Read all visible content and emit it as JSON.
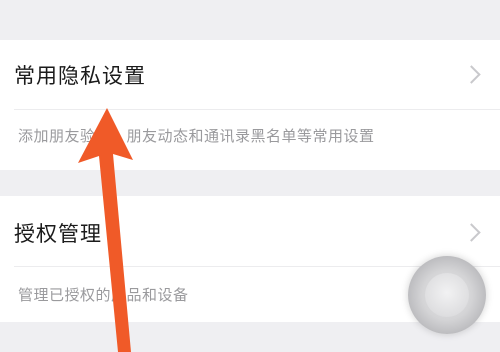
{
  "settings": {
    "items": [
      {
        "title": "常用隐私设置",
        "description": "添加朋友验证、朋友动态和通讯录黑名单等常用设置"
      },
      {
        "title": "授权管理",
        "description": "管理已授权的产品和设备"
      }
    ]
  },
  "annotation_color": "#f05a28",
  "icons": [
    "chevron-right-icon",
    "floating-assistive-ball-icon",
    "red-pointer-arrow-icon"
  ]
}
